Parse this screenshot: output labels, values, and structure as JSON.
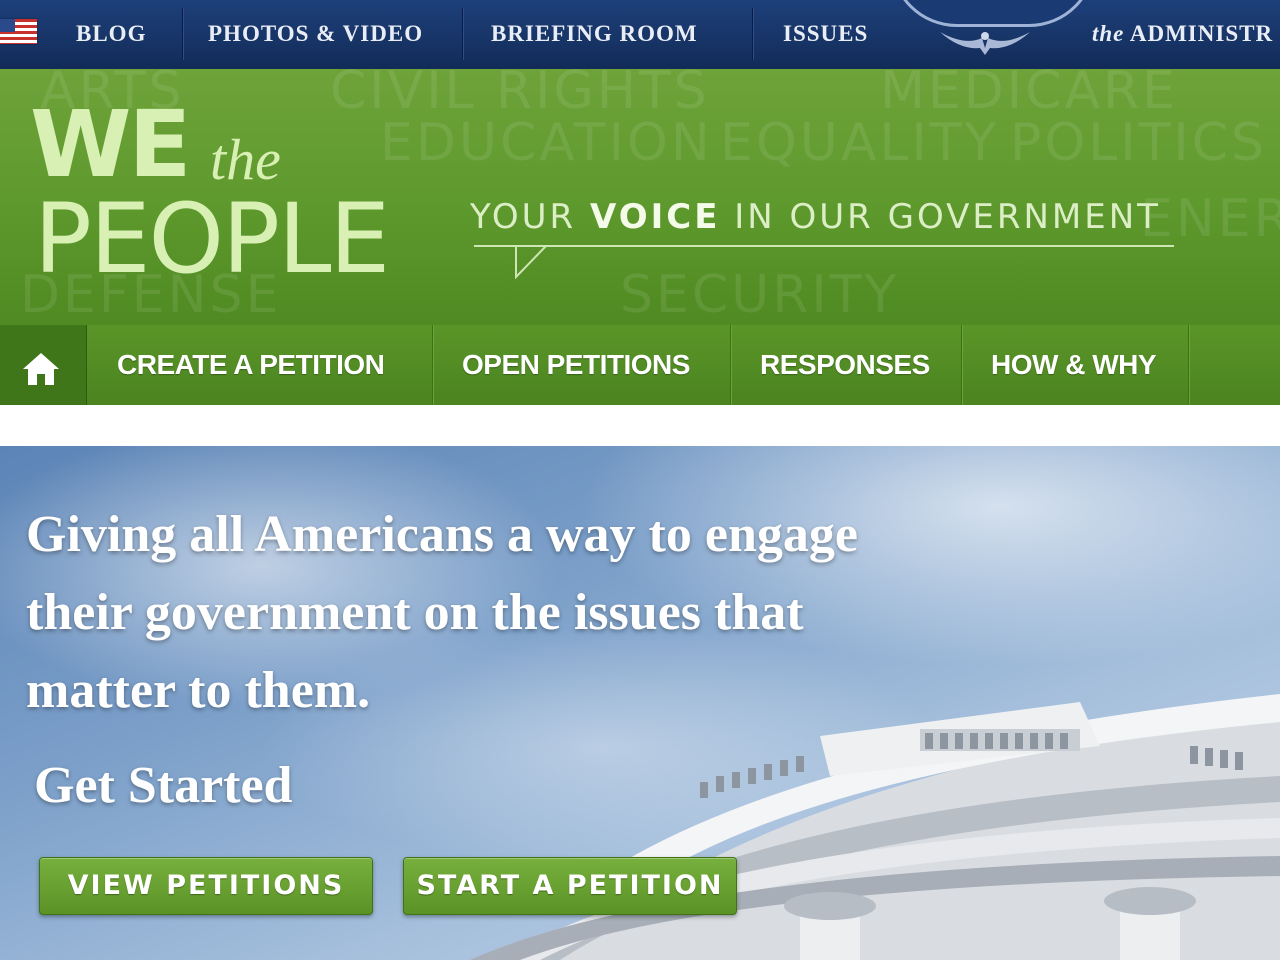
{
  "topnav": {
    "items": [
      "BLOG",
      "PHOTOS & VIDEO",
      "BRIEFING ROOM",
      "ISSUES"
    ],
    "administration": {
      "prefix": "the",
      "label": "ADMINISTR"
    },
    "icons": {
      "flag": "us-flag-icon",
      "eagle": "eagle-icon",
      "seal": "seal-icon"
    }
  },
  "banner": {
    "logo": {
      "we": "WE",
      "the": "the",
      "people": "PEOPLE"
    },
    "tagline": {
      "part1": "YOUR",
      "part2": "VOICE",
      "part3": "IN OUR GOVERNMENT"
    },
    "background_words": [
      "ARTS",
      "CIVIL RIGHTS",
      "MEDICARE",
      "EDUCATION",
      "EQUALITY",
      "POLITICS",
      "DEFENSE",
      "SECURITY",
      "ENERGY"
    ]
  },
  "subnav": {
    "home_icon": "home-icon",
    "items": [
      "CREATE A PETITION",
      "OPEN PETITIONS",
      "RESPONSES",
      "HOW & WHY"
    ]
  },
  "hero": {
    "text_lines": [
      "Giving all Americans a way to engage",
      "their government on the issues that",
      "matter to them."
    ],
    "subheading": "Get Started",
    "buttons": [
      "VIEW PETITIONS",
      "START A PETITION"
    ]
  },
  "colors": {
    "topnav": "#173466",
    "banner_green": "#5f9a2e",
    "subnav_green": "#4b8420",
    "logo_text": "#d9f0b4",
    "button_green": "#6aa232"
  }
}
